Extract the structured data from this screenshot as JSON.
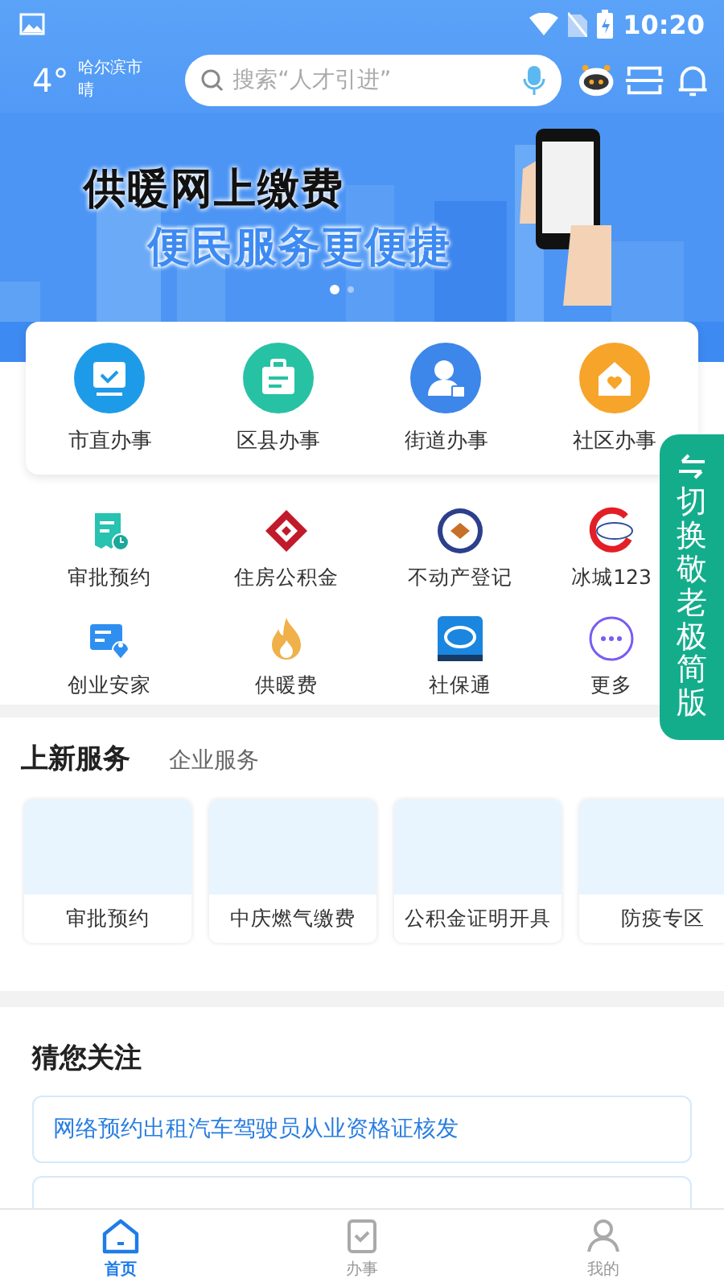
{
  "status_bar": {
    "time": "10:20"
  },
  "header": {
    "temperature": "4°",
    "city": "哈尔滨市",
    "weather": "晴",
    "search": {
      "placeholder": "搜索“人才引进”"
    }
  },
  "banner": {
    "title": "供暖网上缴费",
    "subtitle": "便民服务更便捷"
  },
  "office_levels": [
    {
      "label": "市直办事"
    },
    {
      "label": "区县办事"
    },
    {
      "label": "街道办事"
    },
    {
      "label": "社区办事"
    }
  ],
  "services": [
    {
      "label": "审批预约"
    },
    {
      "label": "住房公积金"
    },
    {
      "label": "不动产登记"
    },
    {
      "label": "冰城123"
    },
    {
      "label": "创业安家"
    },
    {
      "label": "供暖费"
    },
    {
      "label": "社保通"
    },
    {
      "label": "更多"
    }
  ],
  "elder_mode_tab": {
    "label": "切换敬老极简版"
  },
  "section_tabs": [
    {
      "label": "上新服务",
      "selected": true
    },
    {
      "label": "企业服务",
      "selected": false
    }
  ],
  "new_services": [
    {
      "label": "审批预约"
    },
    {
      "label": "中庆燃气缴费"
    },
    {
      "label": "公积金证明开具"
    },
    {
      "label": "防疫专区"
    }
  ],
  "recommend": {
    "title": "猜您关注",
    "items": [
      {
        "kind": "text",
        "label": "网络预约出租汽车驾驶员从业资格证核发"
      },
      {
        "kind": "partial"
      }
    ]
  },
  "bottom_nav": [
    {
      "label": "首页",
      "selected": true
    },
    {
      "label": "办事",
      "selected": false
    },
    {
      "label": "我的",
      "selected": false
    }
  ]
}
